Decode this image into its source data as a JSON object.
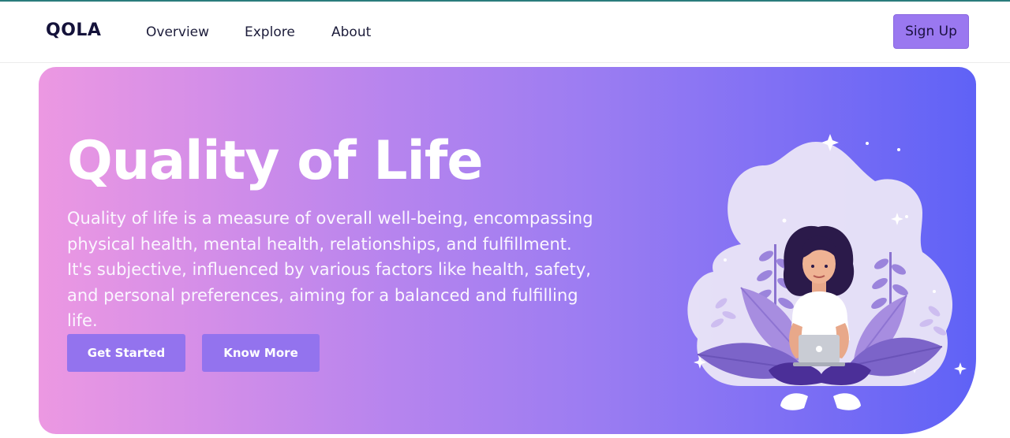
{
  "brand": {
    "logo_text": "QOLA"
  },
  "nav": {
    "items": [
      "Overview",
      "Explore",
      "About"
    ]
  },
  "header": {
    "signup_label": "Sign Up"
  },
  "hero": {
    "title": "Quality of Life",
    "description": "Quality of life is a measure of overall well-being, encompassing physical health, mental health, relationships, and fulfillment. It's subjective, influenced by various factors like health, safety, and personal preferences, aiming for a balanced and fulfilling life.",
    "primary_button": "Get Started",
    "secondary_button": "Know More",
    "gradient_colors": [
      "#ec98e2",
      "#9a7cf2",
      "#5f62f6"
    ],
    "illustration": "woman-with-laptop-meditating-illustration"
  },
  "colors": {
    "accent": "#9a78f0",
    "button": "#9373ee",
    "brand_text": "#14123a"
  }
}
